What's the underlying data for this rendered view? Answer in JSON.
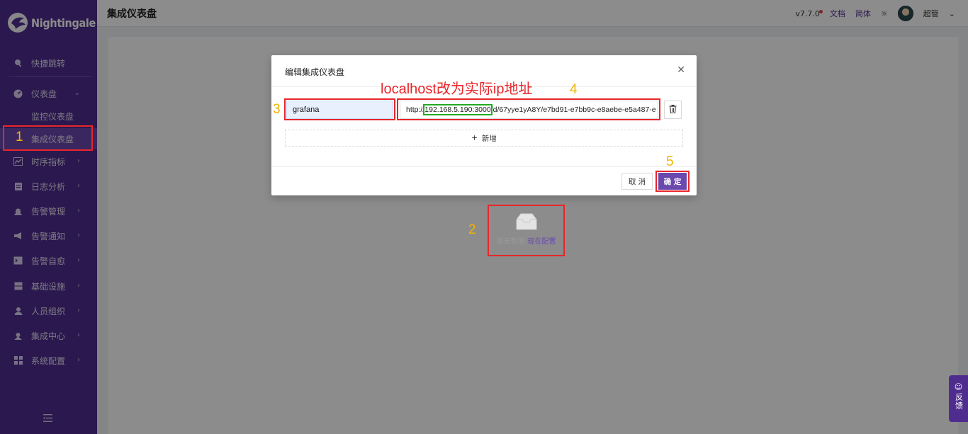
{
  "brand": {
    "name": "Nightingale"
  },
  "header": {
    "title": "集成仪表盘",
    "version": "v7.7.0",
    "docs": "文档",
    "language": "简体",
    "user": "超管"
  },
  "sidebar": {
    "items": [
      {
        "label": "快捷跳转",
        "icon": "search-icon"
      },
      {
        "label": "仪表盘",
        "icon": "dashboard-icon"
      },
      {
        "label": "监控仪表盘"
      },
      {
        "label": "集成仪表盘"
      },
      {
        "label": "时序指标",
        "icon": "line-chart-icon"
      },
      {
        "label": "日志分析",
        "icon": "log-icon"
      },
      {
        "label": "告警管理",
        "icon": "alarm-icon"
      },
      {
        "label": "告警通知",
        "icon": "megaphone-icon"
      },
      {
        "label": "告警自愈",
        "icon": "terminal-icon"
      },
      {
        "label": "基础设施",
        "icon": "server-icon"
      },
      {
        "label": "人员组织",
        "icon": "user-icon"
      },
      {
        "label": "集成中心",
        "icon": "integration-icon"
      },
      {
        "label": "系统配置",
        "icon": "settings-grid-icon"
      }
    ]
  },
  "empty": {
    "text": "暂无数据",
    "link": "现在配置"
  },
  "modal": {
    "title": "编辑集成仪表盘",
    "name_value": "grafana",
    "url_prefix": "http://",
    "url_ip": "192.168.5.190:3000",
    "url_suffix": "/d/67yye1yA8Y/e7bd91-e7bb9c-e8aebe-e5a487-e",
    "add_label": "新增",
    "cancel_label": "取 消",
    "ok_label": "确 定"
  },
  "annotations": {
    "note": "localhost改为实际ip地址",
    "n1": "1",
    "n2": "2",
    "n3": "3",
    "n4": "4",
    "n5": "5"
  },
  "feedback": {
    "label": "反馈"
  }
}
